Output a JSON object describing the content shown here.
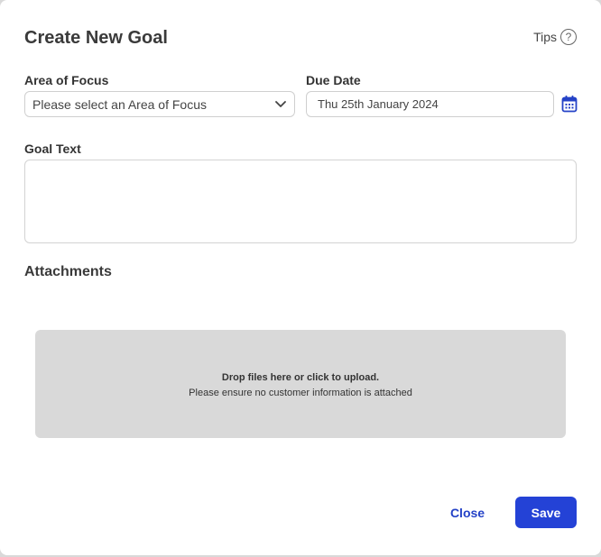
{
  "dialog": {
    "title": "Create New Goal",
    "tips_label": "Tips",
    "tips_icon": "question-circle-icon"
  },
  "form": {
    "area_of_focus": {
      "label": "Area of Focus",
      "selected": "Please select an Area of Focus"
    },
    "due_date": {
      "label": "Due Date",
      "value": "Thu 25th January 2024",
      "icon": "calendar-icon"
    },
    "goal_text": {
      "label": "Goal Text",
      "value": ""
    }
  },
  "attachments": {
    "title": "Attachments",
    "dropzone_main": "Drop files here or click to upload.",
    "dropzone_sub": "Please ensure no customer information is attached"
  },
  "footer": {
    "close_label": "Close",
    "save_label": "Save"
  },
  "colors": {
    "accent": "#2442d6",
    "link": "#2442c7",
    "dropzone_bg": "#d9d9d9"
  }
}
